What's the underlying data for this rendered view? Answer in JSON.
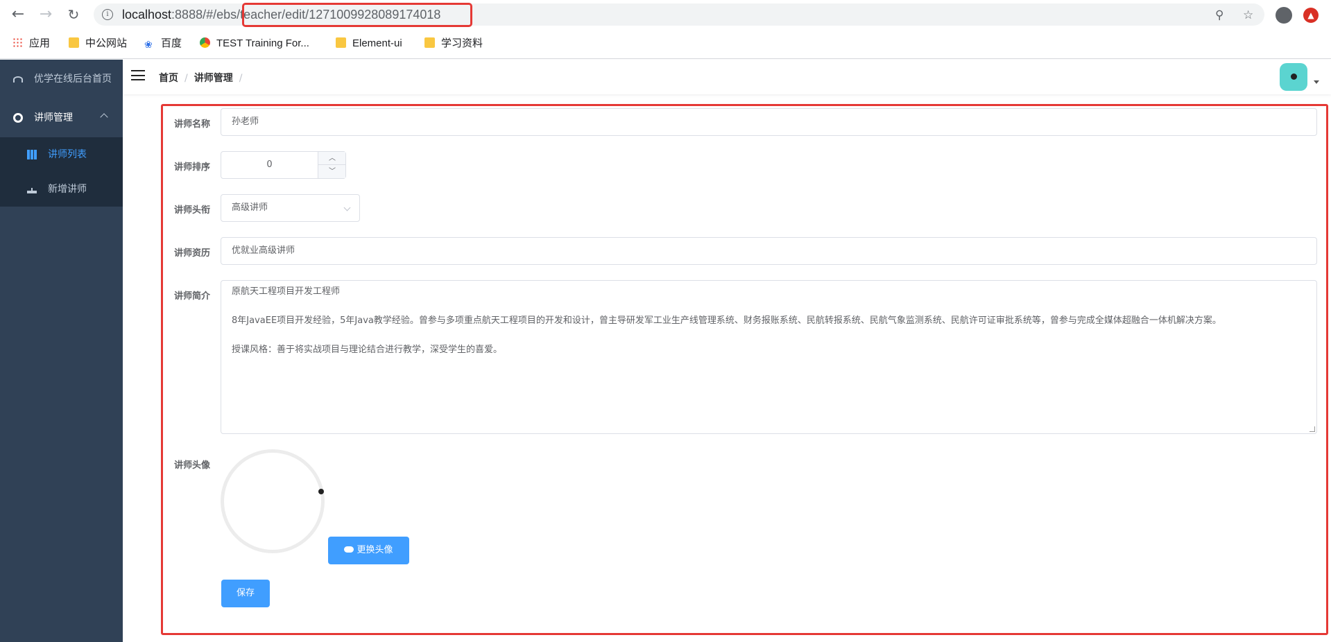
{
  "browser": {
    "url_host": "localhost",
    "url_rest": ":8888/#/ebs/teacher/edit/1271009928089174018",
    "bookmarks": [
      "应用",
      "中公网站",
      "百度",
      "TEST Training For...",
      "Element-ui",
      "学习资料"
    ]
  },
  "sidebar": {
    "items": [
      {
        "label": "优学在线后台首页",
        "icon": "dashboard-icon"
      },
      {
        "label": "讲师管理",
        "icon": "gear-icon"
      },
      {
        "label": "讲师列表",
        "icon": "table-icon"
      },
      {
        "label": "新增讲师",
        "icon": "tree-icon"
      }
    ]
  },
  "header": {
    "breadcrumb": [
      "首页",
      "讲师管理"
    ],
    "breadcrumb_sep": "/"
  },
  "form": {
    "name_label": "讲师名称",
    "name_value": "孙老师",
    "sort_label": "讲师排序",
    "sort_value": "0",
    "level_label": "讲师头衔",
    "level_value": "高级讲师",
    "career_label": "讲师资历",
    "career_value": "优就业高级讲师",
    "intro_label": "讲师简介",
    "intro_lines": [
      "原航天工程项目开发工程师",
      "8年JavaEE项目开发经验，5年Java教学经验。曾参与多项重点航天工程项目的开发和设计，曾主导研发军工业生产线管理系统、财务报账系统、民航转报系统、民航气象监测系统、民航许可证审批系统等，曾参与完成全媒体超融合一体机解决方案。",
      "授课风格：善于将实战项目与理论结合进行教学，深受学生的喜爱。"
    ],
    "avatar_label": "讲师头像",
    "change_avatar_button": "更换头像",
    "save_button": "保存"
  },
  "colors": {
    "sidebar_bg": "#304156",
    "primary": "#409eff",
    "highlight_red": "#e53935"
  }
}
